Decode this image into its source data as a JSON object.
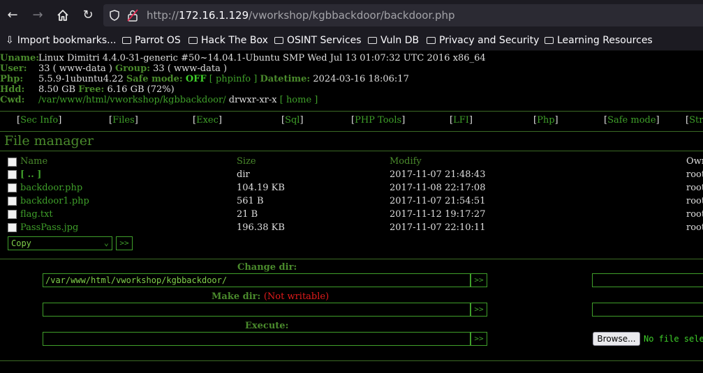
{
  "browser": {
    "url_prefix": "http://",
    "url_host": "172.16.1.129",
    "url_path": "/vworkshop/kgbbackdoor/backdoor.php",
    "bookmarks": [
      "Import bookmarks...",
      "Parrot OS",
      "Hack The Box",
      "OSINT Services",
      "Vuln DB",
      "Privacy and Security",
      "Learning Resources"
    ]
  },
  "sysinfo": {
    "uname_label": "Uname:",
    "uname": "Linux Dimitri 4.4.0-31-generic #50~14.04.1-Ubuntu SMP Wed Jul 13 01:07:32 UTC 2016 x86_64",
    "user_label": "User:",
    "user": "33 ( www-data )",
    "group_label": "Group:",
    "group": "33 ( www-data )",
    "php_label": "Php:",
    "php": "5.5.9-1ubuntu4.22",
    "safe_mode_label": "Safe mode:",
    "safe_mode": "OFF",
    "phpinfo_link": "[ phpinfo ]",
    "datetime_label": "Datetime:",
    "datetime": "2024-03-16 18:06:17",
    "hdd_label": "Hdd:",
    "hdd": "8.50 GB",
    "free_label": "Free:",
    "free": "6.16 GB (72%)",
    "cwd_label": "Cwd:",
    "cwd": "/var/www/html/vworkshop/kgbbackdoor/",
    "perms": "drwxr-xr-x",
    "home_link": "[ home ]"
  },
  "menu": [
    "Sec Info",
    "Files",
    "Exec",
    "Sql",
    "PHP Tools",
    "LFI",
    "Php",
    "Safe mode",
    "Stri"
  ],
  "file_manager": {
    "title": "File manager",
    "columns": [
      "Name",
      "Size",
      "Modify",
      "Own"
    ],
    "rows": [
      {
        "name": "[ .. ]",
        "size": "dir",
        "modify": "2017-11-07 21:48:43",
        "owner": "root"
      },
      {
        "name": "backdoor.php",
        "size": "104.19 KB",
        "modify": "2017-11-08 22:17:08",
        "owner": "root"
      },
      {
        "name": "backdoor1.php",
        "size": "561 B",
        "modify": "2017-11-07 21:54:51",
        "owner": "root"
      },
      {
        "name": "flag.txt",
        "size": "21 B",
        "modify": "2017-11-12 19:17:27",
        "owner": "root"
      },
      {
        "name": "PassPass.jpg",
        "size": "196.38 KB",
        "modify": "2017-11-07 22:10:11",
        "owner": "root"
      }
    ],
    "action_select": "Copy",
    "go_label": ">>"
  },
  "forms": {
    "change_dir_label": "Change dir:",
    "change_dir_value": "/var/www/html/vworkshop/kgbbackdoor/",
    "make_dir_label": "Make dir:",
    "not_writable": "(Not writable)",
    "execute_label": "Execute:",
    "go_label": ">>",
    "browse_label": "Browse...",
    "no_file": "No file sele"
  }
}
